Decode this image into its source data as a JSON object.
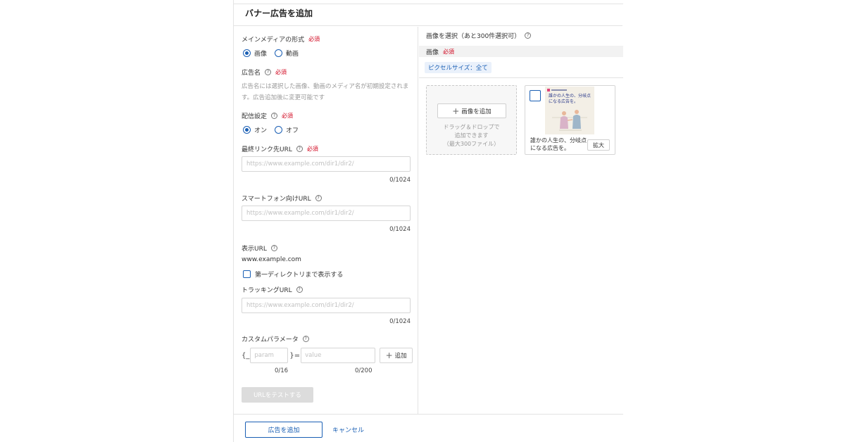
{
  "dialog": {
    "title": "バナー広告を追加"
  },
  "form": {
    "media_format": {
      "label": "メインメディアの形式",
      "required": "必須",
      "options": [
        "画像",
        "動画"
      ],
      "selected": "画像"
    },
    "ad_name": {
      "label": "広告名",
      "required": "必須",
      "helptext": "広告名には選択した画像、動画のメディア名が初期設定されます。広告追加後に変更可能です"
    },
    "delivery": {
      "label": "配信設定",
      "required": "必須",
      "options": [
        "オン",
        "オフ"
      ],
      "selected": "オン"
    },
    "final_url": {
      "label": "最終リンク先URL",
      "required": "必須",
      "placeholder": "https://www.example.com/dir1/dir2/",
      "counter": "0/1024"
    },
    "smartphone_url": {
      "label": "スマートフォン向けURL",
      "placeholder": "https://www.example.com/dir1/dir2/",
      "counter": "0/1024"
    },
    "display_url": {
      "label": "表示URL",
      "value": "www.example.com",
      "checkbox_label": "第一ディレクトリまで表示する"
    },
    "tracking_url": {
      "label": "トラッキングURL",
      "placeholder": "https://www.example.com/dir1/dir2/",
      "counter": "0/1024"
    },
    "custom_params": {
      "label": "カスタムパラメータ",
      "open_brace": "{_",
      "close_brace": "}=",
      "param_placeholder": "param",
      "value_placeholder": "value",
      "add_label": "追加",
      "param_counter": "0/16",
      "value_counter": "0/200"
    },
    "test_button": "URLをテストする"
  },
  "image_panel": {
    "title": "画像を選択（あと300件選択可）",
    "section_label": "画像",
    "section_required": "必須",
    "filter_chip": "ピクセルサイズ：全て",
    "upload_button": "画像を追加",
    "dropzone_text": [
      "ドラッグ＆ドロップで",
      "追加できます",
      "（最大300ファイル）"
    ],
    "thumbnail": {
      "caption": "誰かの人生の、分岐点になる広告を。",
      "image_text": "誰かの人生の、分岐点になる広告を。",
      "expand_button": "拡大"
    }
  },
  "footer": {
    "add_ad_button": "広告を追加",
    "cancel_link": "キャンセル"
  },
  "colors": {
    "accent": "#1a5fb4",
    "required": "#d0021b",
    "border": "#e3e3e3"
  }
}
